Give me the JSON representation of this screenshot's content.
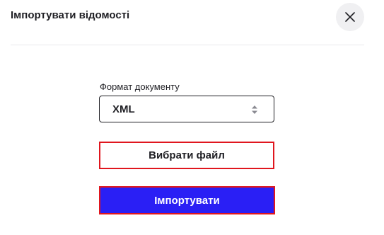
{
  "dialog": {
    "title": "Імпортувати відомості",
    "close_icon": "close-icon"
  },
  "form": {
    "format_label": "Формат документу",
    "format_value": "XML",
    "select_icon": "sort-arrows-icon",
    "choose_file_label": "Вибрати файл",
    "import_label": "Імпортувати"
  },
  "colors": {
    "primary": "#2a1ff5",
    "outline_highlight": "#e0161e",
    "text": "#1f1f24",
    "close_bg": "#f0f0f2"
  }
}
